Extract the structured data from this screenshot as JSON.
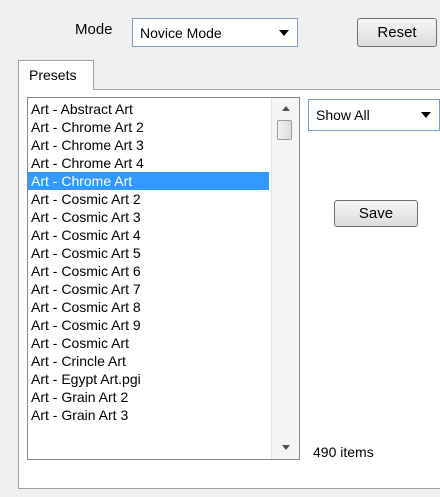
{
  "header": {
    "mode_label": "Mode",
    "mode_value": "Novice Mode",
    "reset_label": "Reset"
  },
  "tabs": [
    {
      "label": "Presets",
      "active": true
    }
  ],
  "presets": {
    "items": [
      "Art - Abstract Art",
      "Art - Chrome Art 2",
      "Art - Chrome Art 3",
      "Art - Chrome Art 4",
      "Art - Chrome Art",
      "Art - Cosmic Art 2",
      "Art - Cosmic Art 3",
      "Art - Cosmic Art 4",
      "Art - Cosmic Art 5",
      "Art - Cosmic Art 6",
      "Art - Cosmic Art 7",
      "Art - Cosmic Art 8",
      "Art - Cosmic Art 9",
      "Art - Cosmic Art",
      "Art - Crincle Art",
      "Art - Egypt Art.pgi",
      "Art - Grain Art 2",
      "Art - Grain Art 3"
    ],
    "selected_index": 4,
    "filter_value": "Show All",
    "save_label": "Save",
    "count_text": "490 items"
  },
  "icons": {
    "mode_dropdown": "chevron-down-icon",
    "filter_dropdown": "chevron-down-icon",
    "scroll_up": "arrow-up-icon",
    "scroll_down": "arrow-down-icon"
  },
  "colors": {
    "selection": "#3399ff",
    "selection_text": "#ffffff",
    "window_bg": "#f0f0f0"
  }
}
